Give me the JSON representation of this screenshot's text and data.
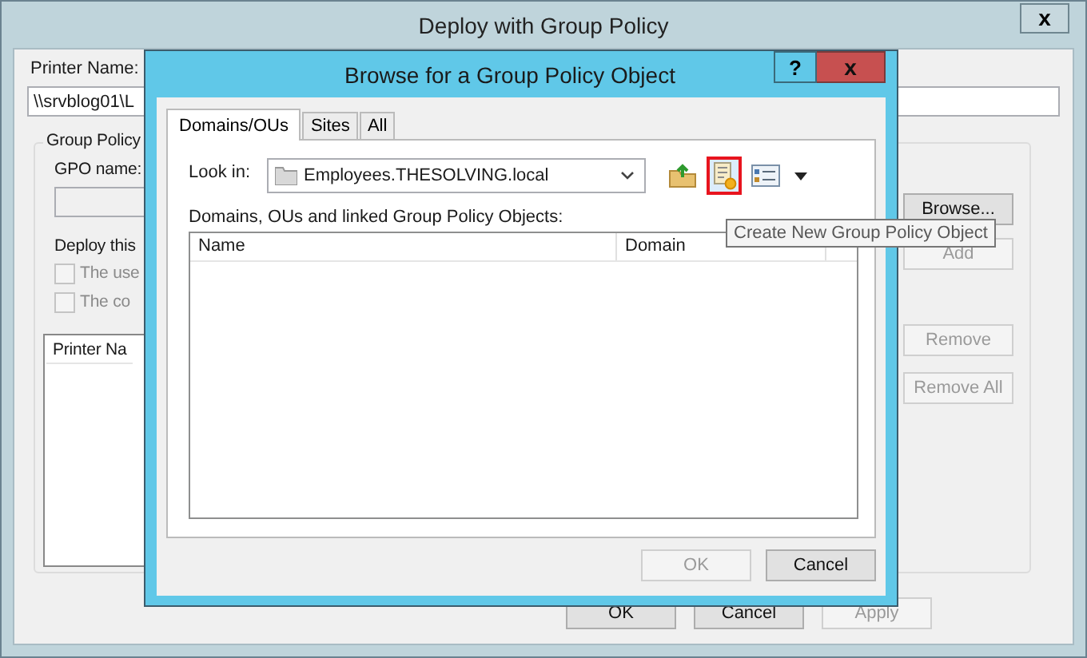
{
  "window": {
    "title": "Deploy with Group Policy",
    "close": "x"
  },
  "printer_name": {
    "label": "Printer Name:",
    "value": "\\\\srvblog01\\L"
  },
  "group_box": {
    "label": "Group Policy",
    "gpo_label": "GPO name:",
    "browse": "Browse...",
    "deploy_label": "Deploy this",
    "add": {
      "label": "Add",
      "disabled": true
    },
    "checkboxes": [
      {
        "label": "The use",
        "checked": false,
        "disabled": true
      },
      {
        "label": "The co",
        "checked": false,
        "disabled": true
      }
    ],
    "list_header": "Printer Na",
    "side_buttons": [
      {
        "label": "Remove",
        "disabled": true
      },
      {
        "label": "Remove All",
        "disabled": true
      }
    ]
  },
  "footer_buttons": [
    {
      "label": "OK",
      "disabled": false
    },
    {
      "label": "Cancel",
      "disabled": false
    },
    {
      "label": "Apply",
      "disabled": true
    }
  ],
  "dialog": {
    "title": "Browse for a Group Policy Object",
    "help": "?",
    "close": "x",
    "tabs": [
      {
        "label": "Domains/OUs",
        "selected": true
      },
      {
        "label": "Sites",
        "selected": false
      },
      {
        "label": "All",
        "selected": false
      }
    ],
    "look_in_label": "Look in:",
    "look_in_value": "Employees.THESOLVING.local",
    "toolbar": [
      {
        "kind": "up-folder",
        "highlighted": false
      },
      {
        "kind": "new-gpo",
        "highlighted": true
      },
      {
        "kind": "view",
        "highlighted": false
      },
      {
        "kind": "caret",
        "highlighted": false
      }
    ],
    "list_label": "Domains, OUs and linked Group Policy Objects:",
    "columns": [
      "Name",
      "Domain"
    ],
    "buttons": [
      {
        "label": "OK",
        "disabled": true
      },
      {
        "label": "Cancel",
        "disabled": false
      }
    ]
  },
  "tooltip": "Create New Group Policy Object"
}
